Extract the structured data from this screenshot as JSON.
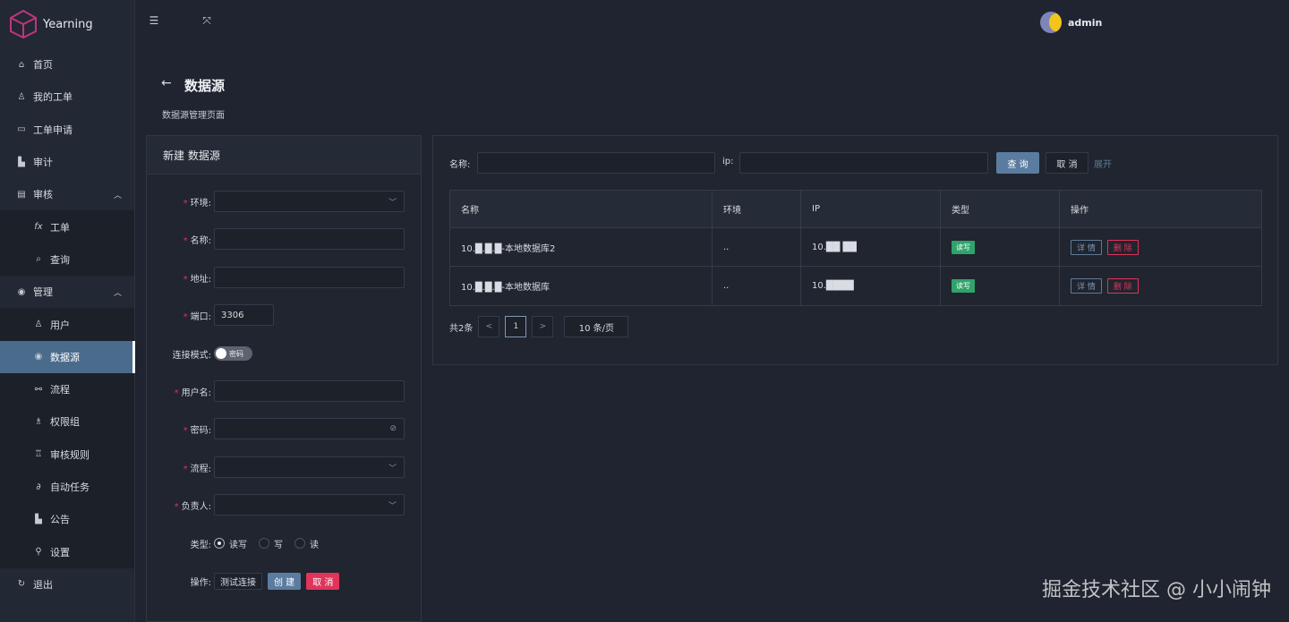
{
  "app": {
    "name": "Yearning",
    "user": "admin"
  },
  "sidebar": {
    "items": [
      {
        "label": "首页",
        "icon": "home-icon"
      },
      {
        "label": "我的工单",
        "icon": "user-icon"
      },
      {
        "label": "工单申请",
        "icon": "monitor-icon"
      },
      {
        "label": "审计",
        "icon": "chart-icon"
      },
      {
        "label": "审核",
        "icon": "audit-icon",
        "expanded": true
      },
      {
        "label": "工单",
        "icon": "fx-icon",
        "sub": true
      },
      {
        "label": "查询",
        "icon": "search-icon",
        "sub": true
      },
      {
        "label": "管理",
        "icon": "eye-icon",
        "expanded": true
      },
      {
        "label": "用户",
        "icon": "user-icon",
        "sub": true
      },
      {
        "label": "数据源",
        "icon": "eye-icon",
        "sub": true,
        "active": true
      },
      {
        "label": "流程",
        "icon": "flow-icon",
        "sub": true
      },
      {
        "label": "权限组",
        "icon": "group-icon",
        "sub": true
      },
      {
        "label": "审核规则",
        "icon": "rule-icon",
        "sub": true
      },
      {
        "label": "自动任务",
        "icon": "paperclip-icon",
        "sub": true
      },
      {
        "label": "公告",
        "icon": "chart-icon",
        "sub": true
      },
      {
        "label": "设置",
        "icon": "wrench-icon",
        "sub": true
      },
      {
        "label": "退出",
        "icon": "logout-icon"
      }
    ]
  },
  "page": {
    "title": "数据源",
    "subtitle": "数据源管理页面"
  },
  "form": {
    "title": "新建 数据源",
    "env_label": "环境:",
    "name_label": "名称:",
    "addr_label": "地址:",
    "port_label": "端口:",
    "port_value": "3306",
    "mode_label": "连接模式:",
    "mode_toggle": "密码",
    "username_label": "用户名:",
    "password_label": "密码:",
    "flow_label": "流程:",
    "owner_label": "负责人:",
    "type_label": "类型:",
    "type_options": [
      "读写",
      "写",
      "读"
    ],
    "op_label": "操作:",
    "test_btn": "测试连接",
    "create_btn": "创 建",
    "cancel_btn": "取 消"
  },
  "search": {
    "name_label": "名称:",
    "ip_label": "ip:",
    "query_btn": "查 询",
    "cancel_btn": "取 消",
    "expand": "展开"
  },
  "table": {
    "columns": [
      "名称",
      "环境",
      "IP",
      "类型",
      "操作"
    ],
    "rows": [
      {
        "name": "10.█.█.█-本地数据库2",
        "env": "..",
        "ip": "10.██ ██",
        "type": "读写",
        "detail": "详 情",
        "delete": "删 除"
      },
      {
        "name": "10.█.█.█-本地数据库",
        "env": "..",
        "ip": "10.████",
        "type": "读写",
        "detail": "详 情",
        "delete": "删 除"
      }
    ]
  },
  "pager": {
    "total": "共2条",
    "current": "1",
    "page_size": "10 条/页"
  },
  "watermark": "掘金技术社区 @ 小小闹钟",
  "colors": {
    "accent": "#5b7ca0",
    "danger": "#e0345a",
    "success": "#2fa36b",
    "sidebar_active": "#4a6b8c"
  }
}
